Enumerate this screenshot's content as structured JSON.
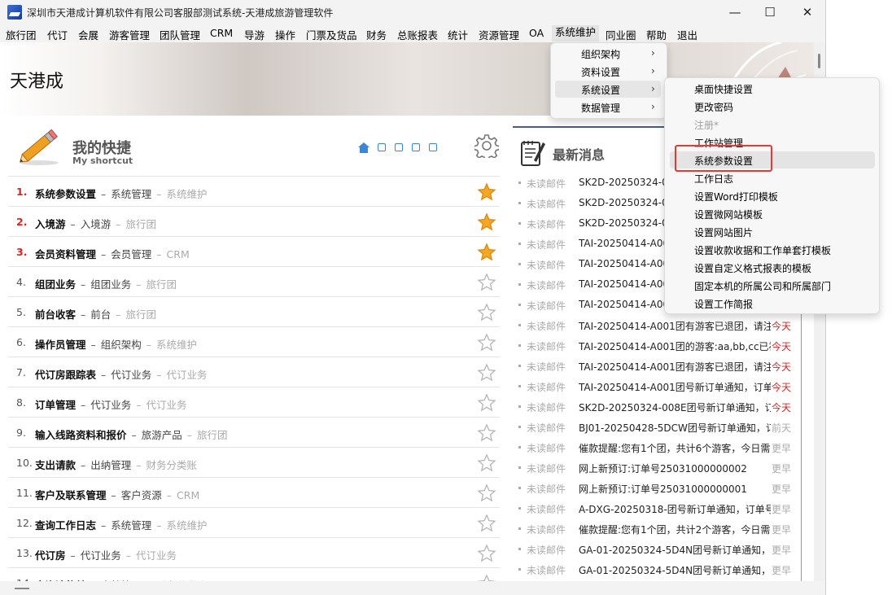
{
  "window": {
    "title": "深圳市天港成计算机软件有限公司客服部测试系统-天港成旅游管理软件",
    "minimize": "—",
    "maximize": "☐",
    "close": "✕"
  },
  "menubar": [
    "旅行团",
    "代订",
    "会展",
    "游客管理",
    "团队管理",
    "CRM",
    "导游",
    "操作",
    "门票及货品",
    "财务",
    "总账报表",
    "统计",
    "资源管理",
    "OA",
    "系统维护",
    "同业圈",
    "帮助",
    "退出"
  ],
  "banner": {
    "title": "天港成"
  },
  "shortcuts": {
    "title": "我的快捷",
    "subtitle": "My shortcut",
    "items": [
      {
        "num": "1.",
        "name": "系统参数设置",
        "module": "系统管理",
        "category": "系统维护",
        "starred": true
      },
      {
        "num": "2.",
        "name": "入境游",
        "module": "入境游",
        "category": "旅行团",
        "starred": true
      },
      {
        "num": "3.",
        "name": "会员资料管理",
        "module": "会员管理",
        "category": "CRM",
        "starred": true
      },
      {
        "num": "4.",
        "name": "组团业务",
        "module": "组团业务",
        "category": "旅行团",
        "starred": false
      },
      {
        "num": "5.",
        "name": "前台收客",
        "module": "前台",
        "category": "旅行团",
        "starred": false
      },
      {
        "num": "6.",
        "name": "操作员管理",
        "module": "组织架构",
        "category": "系统维护",
        "starred": false
      },
      {
        "num": "7.",
        "name": "代订房跟踪表",
        "module": "代订业务",
        "category": "代订业务",
        "starred": false
      },
      {
        "num": "8.",
        "name": "订单管理",
        "module": "代订业务",
        "category": "代订业务",
        "starred": false
      },
      {
        "num": "9.",
        "name": "输入线路资料和报价",
        "module": "旅游产品",
        "category": "旅行团",
        "starred": false
      },
      {
        "num": "10.",
        "name": "支出请款",
        "module": "出纳管理",
        "category": "财务分类账",
        "starred": false
      },
      {
        "num": "11.",
        "name": "客户及联系管理",
        "module": "客户资源",
        "category": "CRM",
        "starred": false
      },
      {
        "num": "12.",
        "name": "查询工作日志",
        "module": "系统管理",
        "category": "系统维护",
        "starred": false
      },
      {
        "num": "13.",
        "name": "代订房",
        "module": "代订业务",
        "category": "代订业务",
        "starred": false
      },
      {
        "num": "14.",
        "name": "查询请款单",
        "module": "出纳管理",
        "category": "财务分类账",
        "starred": false
      }
    ]
  },
  "news": {
    "title": "最新消息",
    "items": [
      {
        "tag": "未读邮件",
        "text": "SK2D-20250324-0",
        "when": "",
        "kind": "today"
      },
      {
        "tag": "未读邮件",
        "text": "SK2D-20250324-0",
        "when": "",
        "kind": "today"
      },
      {
        "tag": "未读邮件",
        "text": "SK2D-20250324-0",
        "when": "",
        "kind": "today"
      },
      {
        "tag": "未读邮件",
        "text": "TAI-20250414-A00",
        "when": "",
        "kind": "today"
      },
      {
        "tag": "未读邮件",
        "text": "TAI-20250414-A00",
        "when": "",
        "kind": "today"
      },
      {
        "tag": "未读邮件",
        "text": "TAI-20250414-A00",
        "when": "",
        "kind": "today"
      },
      {
        "tag": "未读邮件",
        "text": "TAI-20250414-A00",
        "when": "",
        "kind": "today"
      },
      {
        "tag": "未读邮件",
        "text": "TAI-20250414-A001团有游客已退团，请注",
        "when": "今天",
        "kind": "today"
      },
      {
        "tag": "未读邮件",
        "text": "TAI-20250414-A001团的游客:aa,bb,cc已福",
        "when": "今天",
        "kind": "today"
      },
      {
        "tag": "未读邮件",
        "text": "TAI-20250414-A001团有游客已退团，请注",
        "when": "今天",
        "kind": "today"
      },
      {
        "tag": "未读邮件",
        "text": "TAI-20250414-A001团号新订单通知，订单",
        "when": "今天",
        "kind": "today"
      },
      {
        "tag": "未读邮件",
        "text": "SK2D-20250324-008E团号新订单通知，订",
        "when": "今天",
        "kind": "today"
      },
      {
        "tag": "未读邮件",
        "text": "BJ01-20250428-5DCW团号新订单通知，订",
        "when": "前天",
        "kind": "old"
      },
      {
        "tag": "未读邮件",
        "text": "催款提醒:您有1个团，共计6个游客，今日需",
        "when": "更早",
        "kind": "old"
      },
      {
        "tag": "未读邮件",
        "text": "网上新预订:订单号25031000000002",
        "when": "更早",
        "kind": "old"
      },
      {
        "tag": "未读邮件",
        "text": "网上新预订:订单号25031000000001",
        "when": "更早",
        "kind": "old"
      },
      {
        "tag": "未读邮件",
        "text": "A-DXG-20250318-团号新订单通知，订单号",
        "when": "更早",
        "kind": "old"
      },
      {
        "tag": "未读邮件",
        "text": "催款提醒:您有1个团，共计2个游客，今日需",
        "when": "更早",
        "kind": "old"
      },
      {
        "tag": "未读邮件",
        "text": "GA-01-20250324-5D4N团号新订单通知，订",
        "when": "更早",
        "kind": "old"
      },
      {
        "tag": "未读邮件",
        "text": "GA-01-20250324-5D4N团号新订单通知，订",
        "when": "更早",
        "kind": "old"
      }
    ]
  },
  "menu_system_maintenance": {
    "items": [
      {
        "label": "组织架构",
        "arrow": "›"
      },
      {
        "label": "资料设置",
        "arrow": "›"
      },
      {
        "label": "系统设置",
        "arrow": "›",
        "highlighted": true
      },
      {
        "label": "数据管理",
        "arrow": "›"
      }
    ]
  },
  "menu_system_settings": {
    "items": [
      {
        "label": "桌面快捷设置"
      },
      {
        "label": "更改密码"
      },
      {
        "label": "注册*",
        "disabled": true
      },
      {
        "label": "工作站管理"
      },
      {
        "label": "系统参数设置",
        "highlighted": true
      },
      {
        "label": "工作日志"
      },
      {
        "label": "设置Word打印模板"
      },
      {
        "label": "设置微网站模板"
      },
      {
        "label": "设置网站图片"
      },
      {
        "label": "设置收款收据和工作单套打模板"
      },
      {
        "label": "设置自定义格式报表的模板"
      },
      {
        "label": "固定本机的所属公司和所属部门"
      },
      {
        "label": "设置工作简报"
      }
    ]
  },
  "colors": {
    "accent_red": "#e53935",
    "pager_blue": "#3a86d8",
    "star_gold": "#f5a623"
  }
}
